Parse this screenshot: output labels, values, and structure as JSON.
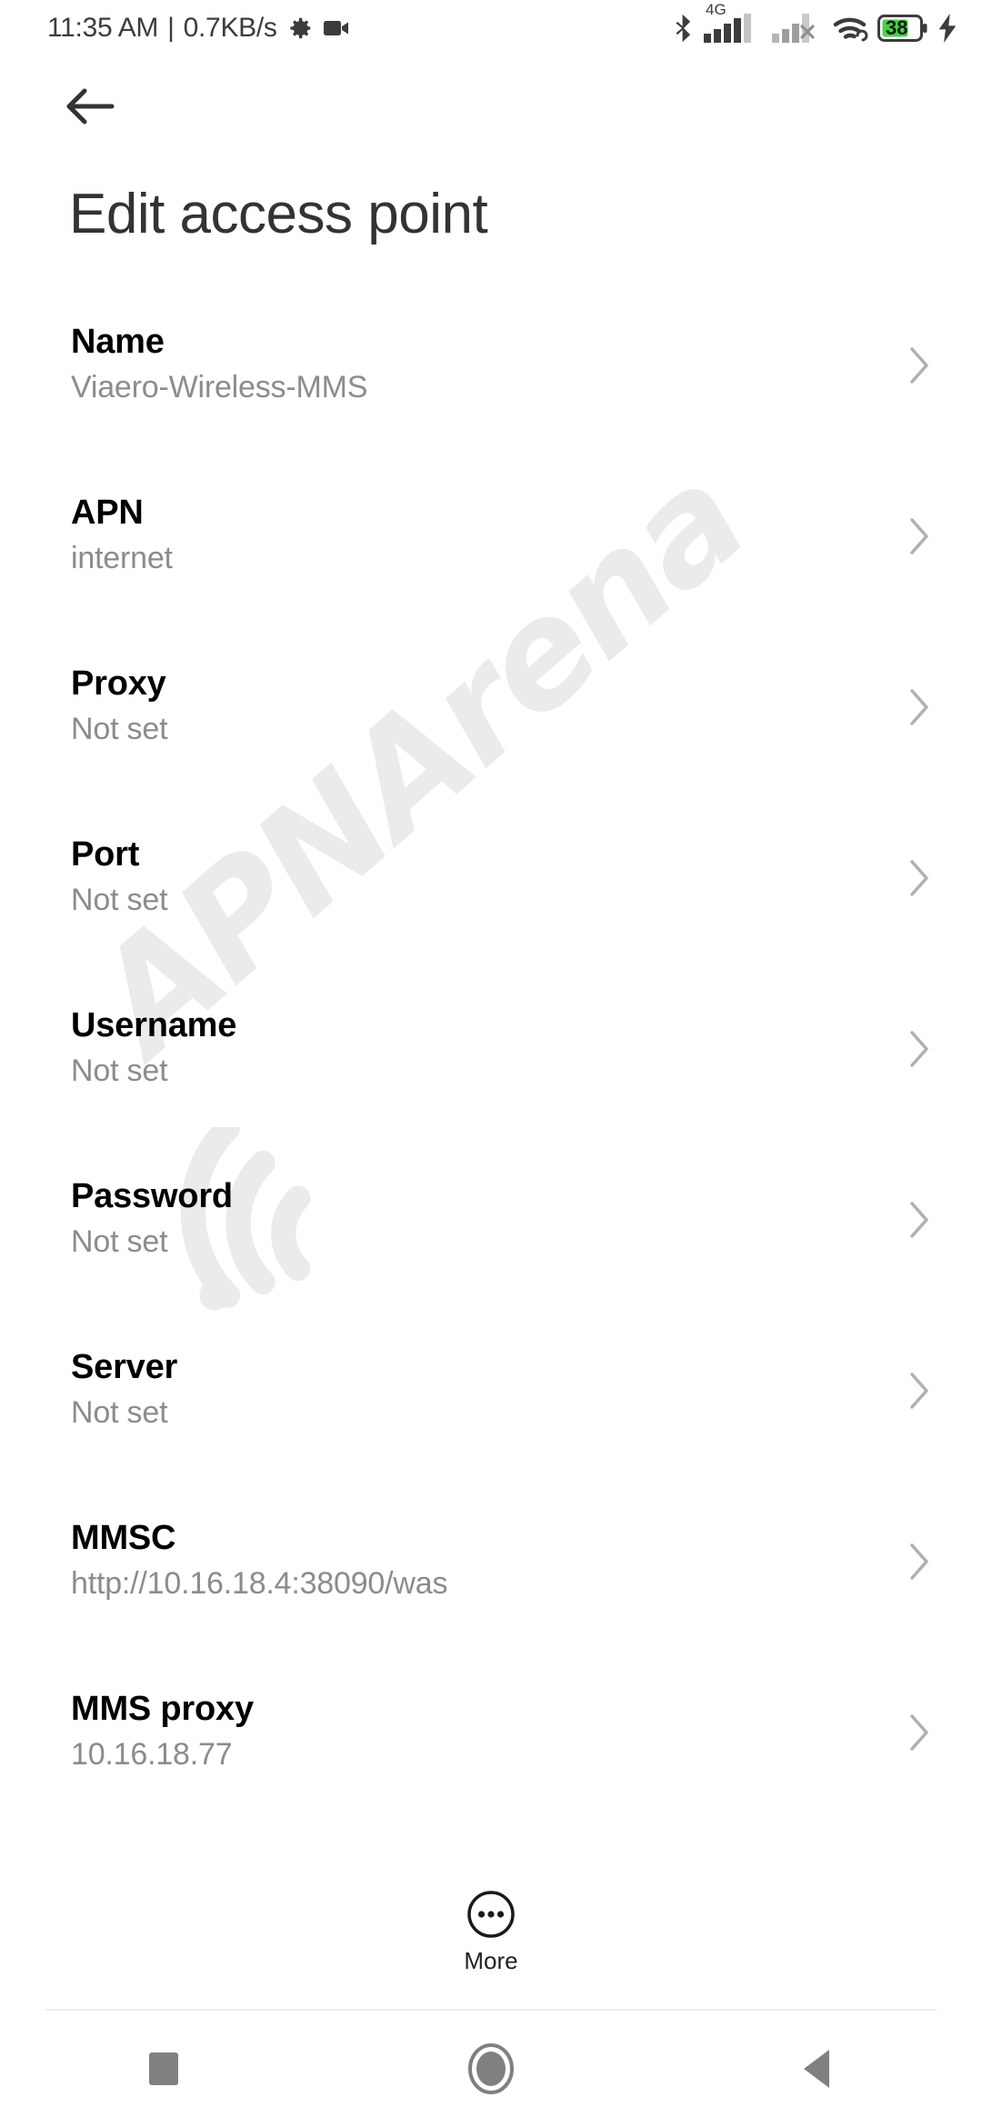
{
  "status_bar": {
    "time": "11:35 AM",
    "separator": "|",
    "network_speed": "0.7KB/s",
    "left_icons": [
      "gear-icon",
      "video-camera-icon"
    ],
    "right_icons": [
      "bluetooth-icon",
      "signal-4g-icon",
      "signal-sim2-no-service-icon",
      "wifi-icon",
      "battery-icon",
      "charging-bolt-icon"
    ],
    "network_type": "4G",
    "battery_level": "38",
    "battery_color": "#4ad147",
    "charging": true
  },
  "navigation": {
    "back_arrow": "back-arrow-icon"
  },
  "header": {
    "title": "Edit access point"
  },
  "list": {
    "chevron": "chevron-right-icon",
    "rows": [
      {
        "title": "Name",
        "subtitle": "Viaero-Wireless-MMS"
      },
      {
        "title": "APN",
        "subtitle": "internet"
      },
      {
        "title": "Proxy",
        "subtitle": "Not set"
      },
      {
        "title": "Port",
        "subtitle": "Not set"
      },
      {
        "title": "Username",
        "subtitle": "Not set"
      },
      {
        "title": "Password",
        "subtitle": "Not set"
      },
      {
        "title": "Server",
        "subtitle": "Not set"
      },
      {
        "title": "MMSC",
        "subtitle": "http://10.16.18.4:38090/was"
      },
      {
        "title": "MMS proxy",
        "subtitle": "10.16.18.77"
      }
    ]
  },
  "more_button": {
    "label": "More",
    "icon": "more-dots-circle-icon"
  },
  "system_nav": {
    "recents": "square-recents-icon",
    "home": "circle-home-icon",
    "back": "triangle-back-icon"
  },
  "watermark": {
    "text": "APNArena",
    "color": "#ebebeb"
  },
  "theme": {
    "background": "#ffffff",
    "title_color": "#333333",
    "row_title_color": "#000000",
    "row_subtitle_color": "#8c8c8c",
    "chevron_color": "#b0b0b0",
    "divider_color": "#ededed",
    "nav_icon_color": "#808080"
  }
}
